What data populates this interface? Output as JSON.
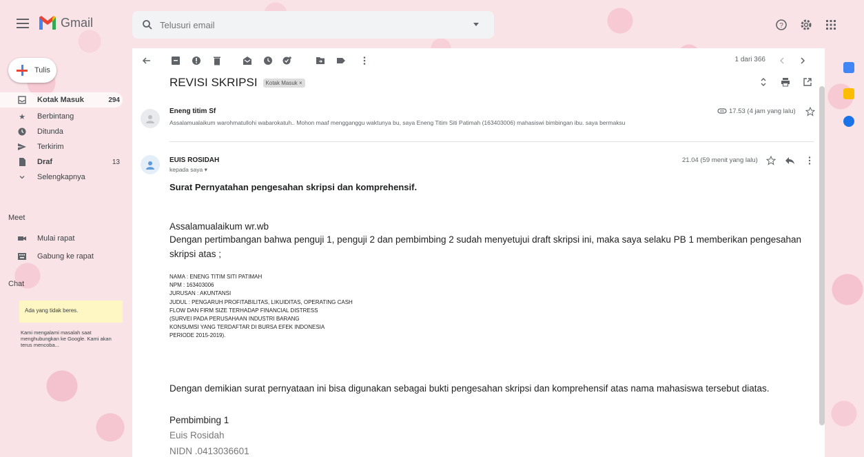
{
  "app": {
    "name": "Gmail",
    "search_placeholder": "Telusuri email"
  },
  "sidebar": {
    "compose_label": "Tulis",
    "items": [
      {
        "label": "Kotak Masuk",
        "count": "294",
        "icon": "inbox-icon",
        "active": true
      },
      {
        "label": "Berbintang",
        "count": "",
        "icon": "star-icon"
      },
      {
        "label": "Ditunda",
        "count": "",
        "icon": "clock-icon"
      },
      {
        "label": "Terkirim",
        "count": "",
        "icon": "send-icon"
      },
      {
        "label": "Draf",
        "count": "13",
        "icon": "draft-icon",
        "bold": true
      },
      {
        "label": "Selengkapnya",
        "count": "",
        "icon": "chevron-down-icon"
      }
    ],
    "meet_label": "Meet",
    "meet_items": [
      {
        "label": "Mulai rapat",
        "icon": "video-icon"
      },
      {
        "label": "Gabung ke rapat",
        "icon": "keyboard-icon"
      }
    ],
    "chat_label": "Chat",
    "chat_warning": "Ada yang tidak beres.",
    "chat_message": "Kami mengalami masalah saat menghubungkan ke Google. Kami akan terus mencoba..."
  },
  "toolbar": {
    "pager": "1 dari 366"
  },
  "thread": {
    "subject": "REVISI SKRIPSI",
    "label_chip": "Kotak Masuk ×"
  },
  "messages": [
    {
      "sender": "Eneng titim Sf",
      "snippet": "Assalamualaikum warohmatullohi wabarokatuh.. Mohon maaf mengganggu waktunya bu, saya Eneng Titim Siti Patimah (163403006) mahasiswi bimbingan ibu. saya bermaksu",
      "time": "17.53 (4 jam yang lalu)"
    },
    {
      "sender": "EUIS ROSIDAH",
      "to": "kepada saya",
      "time": "21.04 (59 menit yang lalu)",
      "body_title": "Surat Pernyatahan pengesahan skripsi dan komprehensif.",
      "greeting": "Assalamualaikum wr.wb",
      "paragraph1": "Dengan pertimbangan bahwa  penguji 1, penguji 2 dan pembimbing 2 sudah menyetujui draft skripsi ini, maka saya selaku PB 1 memberikan pengesahan skripsi atas ;",
      "details": [
        "NAMA : ENENG TITIM SITI PATIMAH",
        "NPM : 163403006",
        "JURUSAN : AKUNTANSI",
        "JUDUL : PENGARUH PROFITABILITAS, LIKUIDITAS, OPERATING CASH",
        "FLOW DAN FIRM SIZE TERHADAP FINANCIAL DISTRESS",
        "(SURVEI PADA PERUSAHAAN INDUSTRI BARANG",
        "KONSUMSI YANG TERDAFTAR DI BURSA EFEK INDONESIA",
        "PERIODE 2015-2019)."
      ],
      "closing": "Dengan demikian surat pernyataan ini bisa digunakan sebagai bukti pengesahan skripsi  dan komprehensif atas nama mahasiswa tersebut diatas.",
      "signature_role": "Pembimbing 1",
      "signature_name": "Euis Rosidah",
      "signature_id": "NIDN .0413036601"
    }
  ]
}
